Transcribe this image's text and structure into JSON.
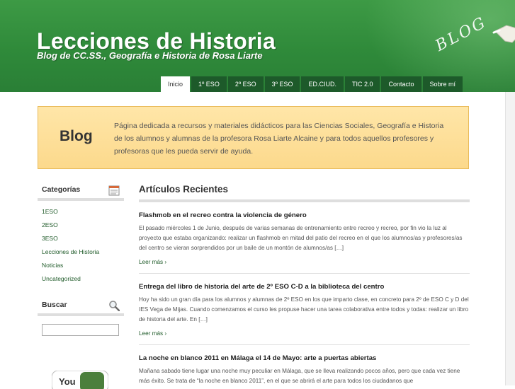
{
  "header": {
    "title": "Lecciones de Historia",
    "tagline": "Blog de CC.SS., Geografía e Historia de Rosa Liarte",
    "chalk_text": "BLOG",
    "colors": {
      "green": "#2f8a3a",
      "nav": "#1d5a2a"
    }
  },
  "nav": {
    "tabs": [
      {
        "label": "Inicio",
        "active": true
      },
      {
        "label": "1º ESO"
      },
      {
        "label": "2º ESO"
      },
      {
        "label": "3º ESO"
      },
      {
        "label": "ED.CIUD."
      },
      {
        "label": "TIC 2.0"
      },
      {
        "label": "Contacto"
      },
      {
        "label": "Sobre mí"
      }
    ]
  },
  "banner": {
    "title": "Blog",
    "text": "Página dedicada a recursos y materiales didácticos para las Ciencias Sociales, Geografía e Historia de los alumnos y alumnas de la profesora Rosa Liarte Alcaine y para todos aquellos profesores y profesoras que les pueda servir de ayuda."
  },
  "sidebar": {
    "categories_title": "Categorías",
    "categories_icon": "calendar-icon",
    "categories": [
      "1ESO",
      "2ESO",
      "3ESO",
      "Lecciones de Historia",
      "Noticias",
      "Uncategorized"
    ],
    "search_title": "Buscar",
    "search_icon": "magnifier-icon",
    "search_value": "",
    "youtube_label": "You"
  },
  "main": {
    "heading": "Artículos Recientes",
    "posts": [
      {
        "title": "Flashmob en el recreo contra la violencia de género",
        "excerpt": "El pasado miércoles 1 de Junio, después de varias semanas de entrenamiento entre recreo y recreo, por fin vio la luz al proyecto que estaba organizando: realizar un flashmob en mitad del patio del recreo en el que los alumnos/as y profesores/as del centro se vieran sorprendidos por un baile de un montón de alumnos/as […]",
        "more": "Leer más ›"
      },
      {
        "title": "Entrega del libro de historia del arte de 2º ESO C-D a la biblioteca del centro",
        "excerpt": "Hoy ha sido un gran día para los alumnos y alumnas de 2º ESO en los que imparto clase, en concreto para 2º de ESO C y D del IES Vega de Mijas. Cuando comenzamos el curso les propuse hacer una tarea colaborativa entre todos y todas: realizar un libro de historia del arte. En […]",
        "more": "Leer más ›"
      },
      {
        "title": "La noche en blanco 2011 en Málaga el 14 de Mayo: arte a puertas abiertas",
        "excerpt": "Mañana sabado tiene lugar una noche muy peculiar en Málaga, que se lleva realizando pocos años, pero que cada vez tiene más éxito. Se trata de “la noche en blanco 2011”, en el que se abrirá el arte para todos los ciudadanos que",
        "more": ""
      }
    ]
  }
}
